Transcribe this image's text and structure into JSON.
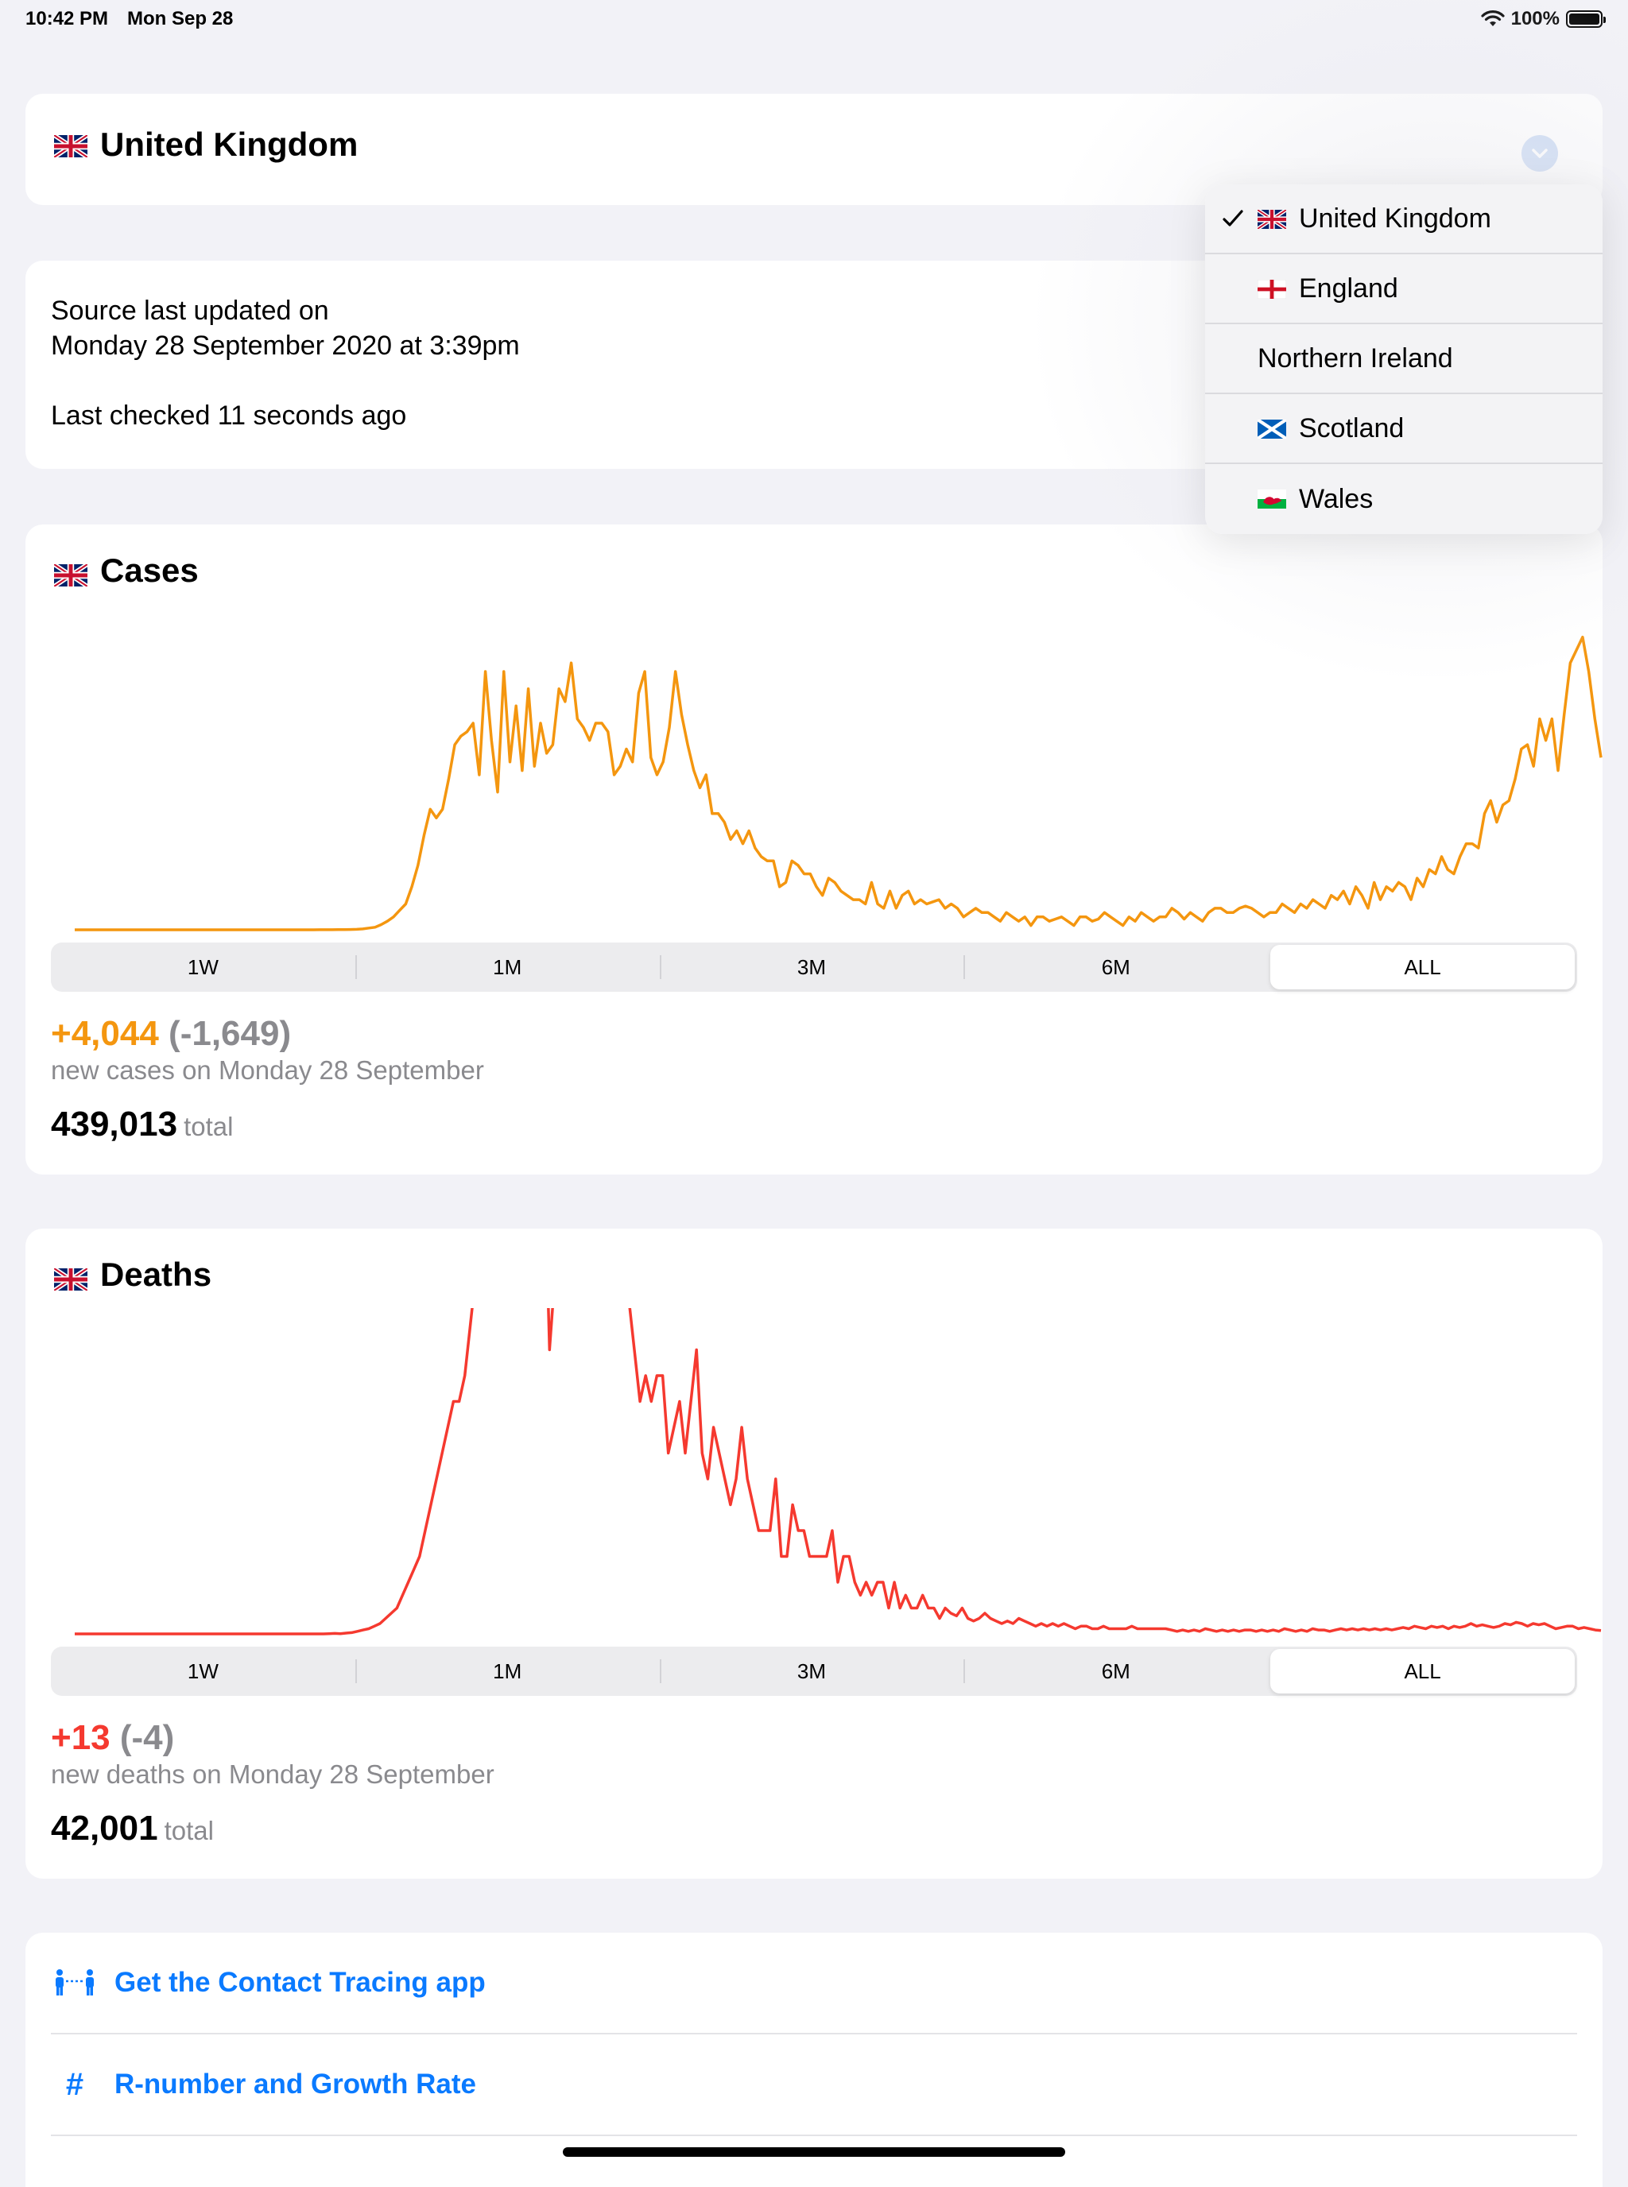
{
  "status": {
    "time": "10:42 PM",
    "date": "Mon Sep 28",
    "battery": "100%"
  },
  "region": {
    "title": "United Kingdom"
  },
  "source": {
    "line1": "Source last updated on",
    "line2": "Monday 28 September 2020 at 3:39pm",
    "line3": "Last checked 11 seconds ago"
  },
  "dropdown": {
    "items": [
      {
        "label": "United Kingdom",
        "selected": true,
        "flag": "uk-flag-icon"
      },
      {
        "label": "England",
        "selected": false,
        "flag": "england-flag-icon"
      },
      {
        "label": "Northern Ireland",
        "selected": false,
        "flag": ""
      },
      {
        "label": "Scotland",
        "selected": false,
        "flag": "scotland-flag-icon"
      },
      {
        "label": "Wales",
        "selected": false,
        "flag": "wales-flag-icon"
      }
    ]
  },
  "cases": {
    "title": "Cases",
    "ranges": [
      "1W",
      "1M",
      "3M",
      "6M",
      "ALL"
    ],
    "active_range": "ALL",
    "new_value": "+4,044",
    "change": "(-1,649)",
    "subtitle": "new cases on Monday 28 September",
    "total": "439,013",
    "total_unit": "total",
    "color": "#f4960f"
  },
  "deaths": {
    "title": "Deaths",
    "ranges": [
      "1W",
      "1M",
      "3M",
      "6M",
      "ALL"
    ],
    "active_range": "ALL",
    "new_value": "+13",
    "change": "(-4)",
    "subtitle": "new deaths on Monday 28 September",
    "total": "42,001",
    "total_unit": "total",
    "color": "#f5392f"
  },
  "links": {
    "contact_tracing": "Get the Contact Tracing app",
    "r_number": "R-number and Growth Rate"
  },
  "chart_data": [
    {
      "type": "line",
      "series": [
        {
          "values": [
            0,
            0,
            0,
            0,
            0,
            0,
            0,
            0,
            0,
            0,
            0,
            0,
            0,
            0,
            0,
            0,
            0,
            0,
            0,
            0,
            0,
            0,
            0,
            0,
            0,
            0,
            0,
            0,
            0,
            0,
            0,
            0,
            0,
            0,
            0,
            0,
            0,
            0,
            0,
            0,
            1,
            1,
            2,
            3,
            5,
            8,
            12,
            20,
            40,
            60,
            120,
            200,
            300,
            450,
            600,
            1000,
            1500,
            2200,
            2800,
            2600,
            2800,
            3500,
            4300,
            4500,
            4600,
            4800,
            3600,
            6000,
            4400,
            3200,
            6000,
            3900,
            5200,
            3700,
            5600,
            3800,
            4800,
            4100,
            4300,
            5600,
            5300,
            6200,
            4900,
            4700,
            4400,
            4800,
            4800,
            4600,
            3600,
            3800,
            4200,
            3900,
            5500,
            6000,
            4000,
            3600,
            3900,
            4700,
            6000,
            5000,
            4300,
            3700,
            3300,
            3600,
            2700,
            2700,
            2500,
            2100,
            2300,
            2000,
            2300,
            1900,
            1700,
            1600,
            1600,
            1000,
            1100,
            1600,
            1500,
            1300,
            1300,
            1000,
            800,
            1200,
            1100,
            900,
            800,
            700,
            700,
            600,
            1100,
            600,
            500,
            900,
            500,
            800,
            900,
            600,
            700,
            600,
            650,
            700,
            500,
            600,
            500,
            300,
            400,
            500,
            400,
            400,
            300,
            200,
            400,
            300,
            200,
            300,
            100,
            300,
            300,
            200,
            250,
            300,
            200,
            100,
            300,
            300,
            200,
            250,
            400,
            300,
            200,
            100,
            300,
            200,
            400,
            300,
            200,
            300,
            300,
            500,
            400,
            250,
            400,
            300,
            200,
            400,
            500,
            500,
            400,
            400,
            500,
            550,
            500,
            400,
            300,
            400,
            400,
            600,
            500,
            400,
            600,
            500,
            700,
            600,
            500,
            800,
            700,
            900,
            600,
            1000,
            800,
            500,
            1100,
            700,
            1000,
            900,
            1100,
            1000,
            700,
            1200,
            1000,
            1400,
            1300,
            1700,
            1400,
            1300,
            1700,
            2000,
            2000,
            1900,
            2700,
            3000,
            2500,
            2900,
            3000,
            3500,
            4200,
            4300,
            3800,
            4900,
            4400,
            4900,
            3700,
            5000,
            6200,
            6500,
            6800,
            6000,
            4900,
            4000
          ]
        }
      ],
      "ylim": [
        0,
        7200
      ]
    },
    {
      "type": "line",
      "series": [
        {
          "values": [
            0,
            0,
            0,
            0,
            0,
            0,
            0,
            0,
            0,
            0,
            0,
            0,
            0,
            0,
            0,
            0,
            0,
            0,
            0,
            0,
            0,
            0,
            0,
            0,
            0,
            0,
            0,
            0,
            0,
            0,
            0,
            0,
            0,
            0,
            0,
            0,
            0,
            0,
            0,
            0,
            0,
            0,
            0,
            0,
            0,
            1,
            2,
            1,
            3,
            5,
            10,
            15,
            20,
            30,
            40,
            60,
            80,
            100,
            150,
            200,
            250,
            300,
            400,
            500,
            600,
            700,
            800,
            900,
            900,
            1000,
            1200,
            1400,
            1600,
            1700,
            1700,
            1800,
            1700,
            1800,
            1600,
            2100,
            1800,
            1500,
            1500,
            1900,
            1100,
            1400,
            1800,
            1800,
            1600,
            1600,
            1700,
            1700,
            1500,
            1500,
            1300,
            1400,
            1300,
            1600,
            1300,
            1100,
            900,
            1000,
            900,
            1000,
            1000,
            700,
            800,
            900,
            700,
            900,
            1100,
            700,
            600,
            800,
            700,
            600,
            500,
            600,
            800,
            600,
            500,
            400,
            400,
            400,
            600,
            300,
            300,
            500,
            400,
            400,
            300,
            300,
            300,
            300,
            400,
            200,
            300,
            300,
            200,
            150,
            200,
            150,
            200,
            200,
            100,
            200,
            100,
            150,
            100,
            100,
            150,
            100,
            100,
            60,
            100,
            80,
            70,
            100,
            60,
            50,
            60,
            80,
            60,
            50,
            40,
            50,
            40,
            60,
            50,
            40,
            30,
            40,
            30,
            40,
            30,
            40,
            30,
            20,
            30,
            30,
            20,
            20,
            30,
            20,
            20,
            20,
            20,
            30,
            20,
            20,
            20,
            20,
            20,
            20,
            15,
            10,
            15,
            10,
            15,
            10,
            20,
            15,
            10,
            15,
            10,
            15,
            10,
            15,
            15,
            10,
            15,
            10,
            15,
            10,
            20,
            15,
            10,
            15,
            10,
            20,
            15,
            15,
            10,
            15,
            20,
            15,
            20,
            15,
            20,
            15,
            20,
            15,
            20,
            15,
            20,
            25,
            20,
            30,
            25,
            20,
            30,
            25,
            30,
            20,
            30,
            25,
            30,
            40,
            30,
            35,
            30,
            25,
            30,
            40,
            35,
            45,
            40,
            30,
            40,
            35,
            40,
            30,
            20,
            25,
            30,
            30,
            20,
            25,
            20,
            15,
            13
          ]
        }
      ],
      "ylim": [
        0,
        1200
      ]
    }
  ]
}
